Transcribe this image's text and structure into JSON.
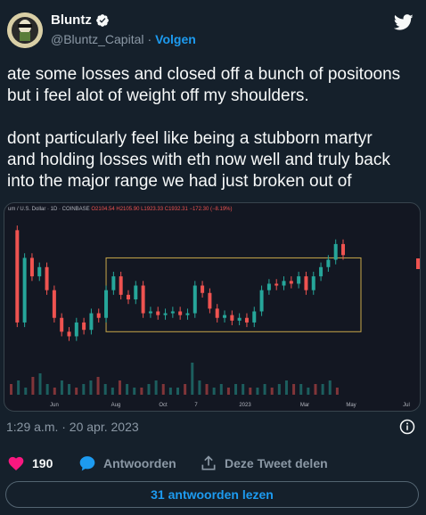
{
  "user": {
    "name": "Bluntz",
    "handle": "@Bluntz_Capital",
    "separator": "·",
    "follow_label": "Volgen"
  },
  "tweet": {
    "text": "ate some losses and closed off a bunch of positoons\nbut i feel alot of weight off my shoulders.\n\n dont particularly feel like being a stubborn martyr\nand holding losses with eth now well and truly back\ninto the major range we had just broken out of",
    "timestamp": "1:29 a.m. · 20 apr. 2023"
  },
  "chart_header": {
    "symbol": "um / U.S. Dollar · 1D · COINBASE",
    "ohlc": "O2104.54 H2105.90 L1923.33 C1932.31 −172.30 (−8.19%)"
  },
  "chart_data": {
    "type": "line",
    "x_labels": [
      "Jun",
      "Aug",
      "Oct",
      "7",
      "2023",
      "Mar",
      "May",
      "Jul"
    ],
    "series": [
      {
        "points": [
          [
            0,
            2.2
          ],
          [
            2,
            1.2
          ],
          [
            4,
            1.9
          ],
          [
            6,
            1.7
          ],
          [
            8,
            1.8
          ],
          [
            10,
            1.55
          ],
          [
            12,
            1.25
          ],
          [
            14,
            1.1
          ],
          [
            16,
            1.05
          ],
          [
            18,
            1.2
          ],
          [
            20,
            1.12
          ],
          [
            22,
            1.3
          ],
          [
            24,
            1.25
          ],
          [
            26,
            1.55
          ],
          [
            28,
            1.7
          ],
          [
            30,
            1.5
          ],
          [
            32,
            1.45
          ],
          [
            34,
            1.6
          ],
          [
            36,
            1.3
          ],
          [
            38,
            1.32
          ],
          [
            40,
            1.28
          ],
          [
            42,
            1.3
          ],
          [
            44,
            1.32
          ],
          [
            46,
            1.28
          ],
          [
            48,
            1.3
          ],
          [
            50,
            1.6
          ],
          [
            52,
            1.52
          ],
          [
            54,
            1.35
          ],
          [
            56,
            1.25
          ],
          [
            58,
            1.28
          ],
          [
            60,
            1.22
          ],
          [
            62,
            1.25
          ],
          [
            64,
            1.2
          ],
          [
            66,
            1.32
          ],
          [
            68,
            1.55
          ],
          [
            70,
            1.62
          ],
          [
            72,
            1.6
          ],
          [
            74,
            1.65
          ],
          [
            76,
            1.62
          ],
          [
            78,
            1.7
          ],
          [
            80,
            1.55
          ],
          [
            82,
            1.7
          ],
          [
            84,
            1.8
          ],
          [
            86,
            1.88
          ],
          [
            88,
            2.05
          ],
          [
            90,
            1.93
          ]
        ]
      }
    ],
    "range_box": {
      "y_low": 1.1,
      "y_high": 1.9
    },
    "volume": [
      3,
      4,
      2,
      5,
      6,
      3,
      2,
      4,
      3,
      2,
      3,
      4,
      5,
      3,
      2,
      4,
      3,
      2,
      2,
      3,
      4,
      3,
      2,
      2,
      3,
      9,
      4,
      3,
      2,
      3,
      2,
      3,
      3,
      2,
      2,
      3,
      2,
      3,
      4,
      3,
      3,
      2,
      3,
      3,
      4,
      2
    ]
  },
  "actions": {
    "like_count": "190",
    "reply_label": "Antwoorden",
    "share_label": "Deze Tweet delen"
  },
  "replies_button": "31 antwoorden lezen",
  "colors": {
    "accent": "#1d9bf0",
    "like": "#f91880",
    "up_candle": "#26a69a",
    "down_candle": "#ef5350",
    "range_box": "#c9a84a"
  },
  "icons": {
    "verified": "verified-badge-icon",
    "logo": "twitter-bird-icon",
    "info": "info-icon",
    "like": "heart-icon",
    "reply": "speech-bubble-icon",
    "share": "share-upload-icon"
  }
}
